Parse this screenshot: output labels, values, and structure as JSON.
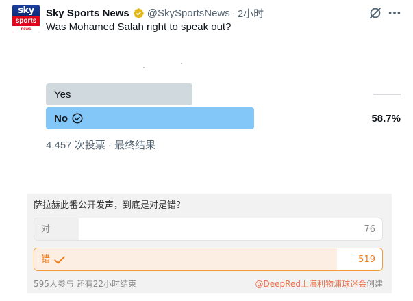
{
  "tweet": {
    "avatar": {
      "line1": "sky",
      "line2": "sports",
      "line3": "news"
    },
    "display_name": "Sky Sports News",
    "handle": "@SkySportsNews",
    "separator": "·",
    "time": "2小时",
    "icons": {
      "grok": "grok-slash-icon",
      "more": "more-dots-icon",
      "verified": "verified-gold-badge-icon"
    },
    "question": "Was Mohamed Salah right to speak out?",
    "poll": {
      "options": [
        {
          "label": "Yes",
          "percent_text": "",
          "fill_fraction": 0.413
        },
        {
          "label": "No",
          "percent_text": "58.7%",
          "fill_fraction": 0.587,
          "selected_winner": true
        }
      ],
      "footer": "4,457 次投票 · 最终结果"
    },
    "colors": {
      "yes_bar": "#cfd9de",
      "no_bar": "#83c6f8",
      "secondary_text": "#536471"
    }
  },
  "weibo_poll": {
    "title": "萨拉赫此番公开发声，到底是对是错？",
    "options": [
      {
        "label": "对",
        "count": "76"
      },
      {
        "label": "错",
        "count": "519",
        "selected": true
      }
    ],
    "footer_left": "595人参与 还有22小时结束",
    "creator": "@DeepRed上海利物浦球迷会",
    "created_suffix": "创建",
    "colors": {
      "accent": "#f07d1a",
      "creator": "#eb7350"
    }
  }
}
